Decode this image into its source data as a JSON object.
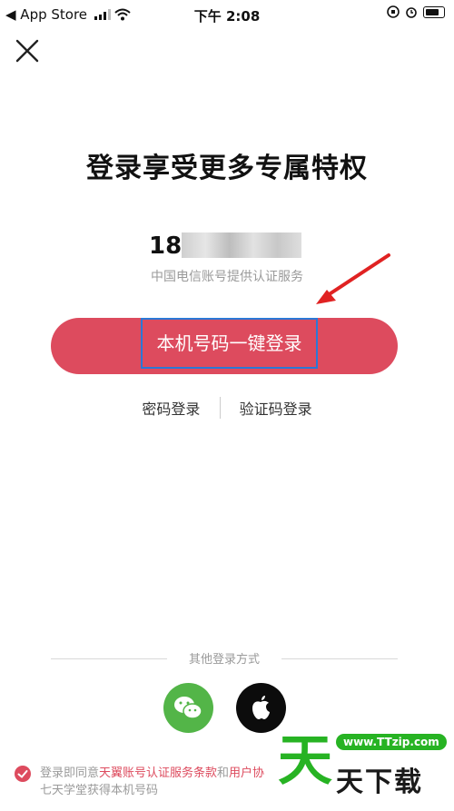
{
  "status_bar": {
    "back_app": "◀ App Store",
    "time": "下午 2:08"
  },
  "title": "登录享受更多专属特权",
  "phone": {
    "visible_prefix": "18"
  },
  "carrier_note": "中国电信账号提供认证服务",
  "primary_button": "本机号码一键登录",
  "alt_logins": {
    "password": "密码登录",
    "sms_code": "验证码登录"
  },
  "other_methods_label": "其他登录方式",
  "social": {
    "wechat_icon": "wechat-icon",
    "apple_icon": "apple-icon"
  },
  "agreement": {
    "prefix": "登录即同意",
    "terms_link": "天翼账号认证服务条款",
    "and": "和",
    "user_link": "用户协",
    "suffix": "七天学堂获得本机号码"
  },
  "watermark": {
    "big": "天",
    "url": "www.TTzip.com",
    "small": "天下载"
  },
  "colors": {
    "accent_red": "#dd4b5e",
    "highlight_blue": "#2b78d6",
    "wechat_green": "#53b548",
    "apple_black": "#0c0c0c"
  }
}
